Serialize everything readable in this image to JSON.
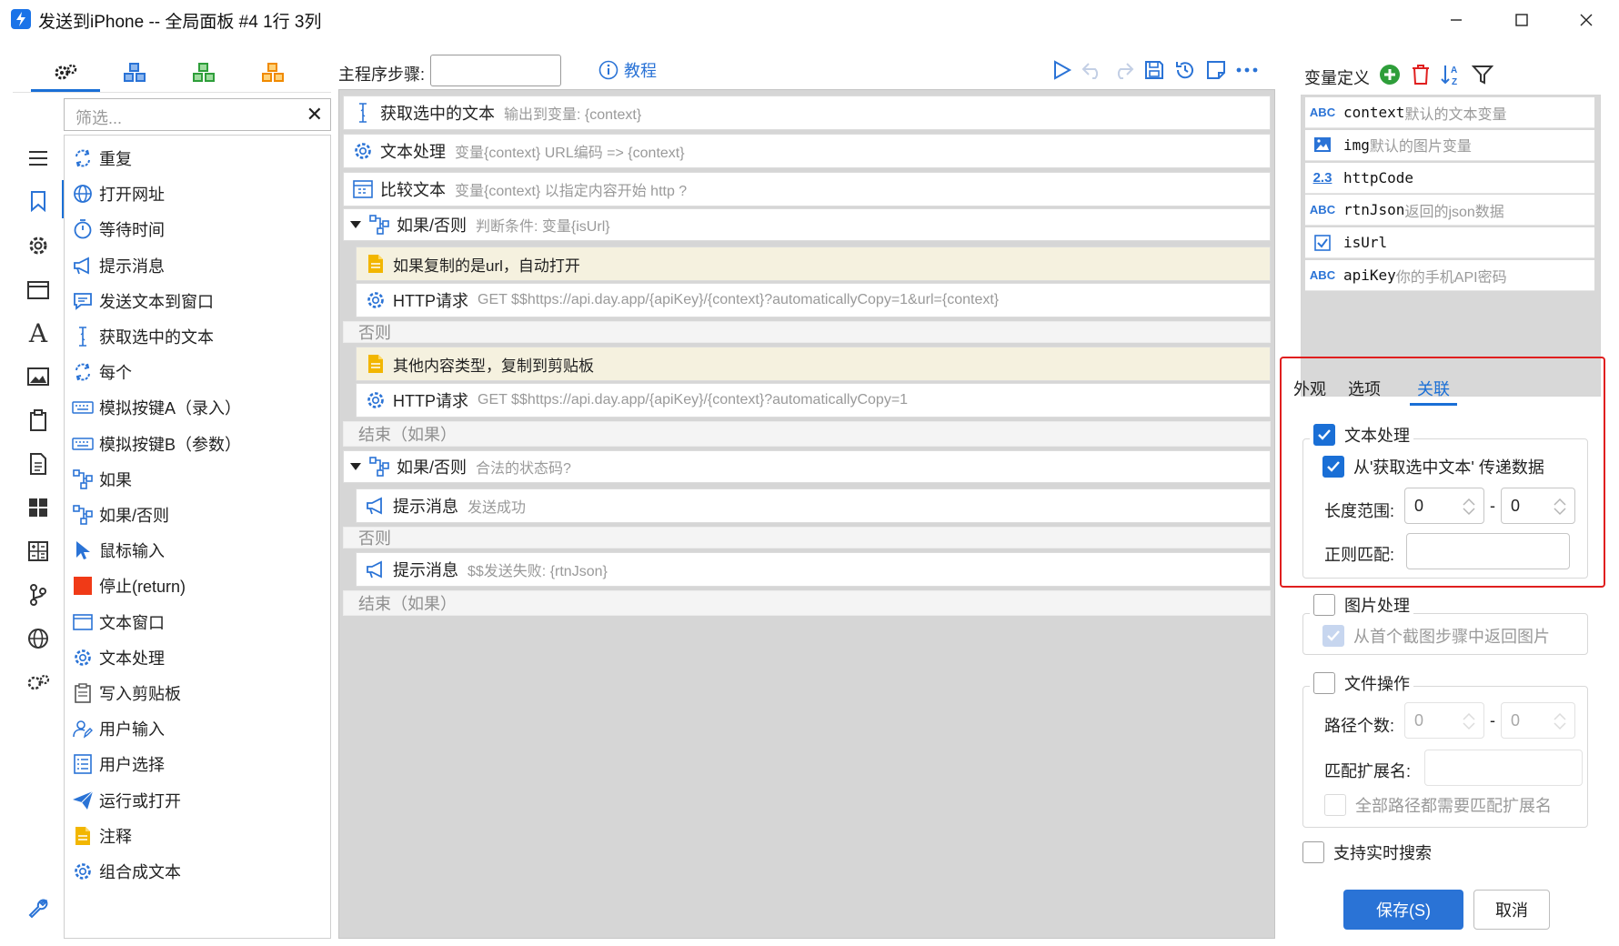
{
  "window": {
    "title": "发送到iPhone -- 全局面板 #4 1行 3列"
  },
  "left": {
    "top_tabs": [
      "gears-icon",
      "cubes-blue-icon",
      "cubes-green-icon",
      "cubes-orange-icon"
    ],
    "filter_placeholder": "筛选...",
    "filter_clear": "✕",
    "side_icons": [
      "menu-icon",
      "bookmark-icon",
      "gear-icon",
      "window-icon",
      "font-icon",
      "image-icon",
      "clipboard-icon",
      "document-icon",
      "windows-icon",
      "calculator-icon",
      "branch-icon",
      "globe-icon",
      "gears-icon",
      "wrench-icon"
    ],
    "steps": [
      {
        "label": "重复",
        "icon": "loop-icon"
      },
      {
        "label": "打开网址",
        "icon": "globe-icon"
      },
      {
        "label": "等待时间",
        "icon": "stopwatch-icon"
      },
      {
        "label": "提示消息",
        "icon": "megaphone-icon"
      },
      {
        "label": "发送文本到窗口",
        "icon": "message-icon"
      },
      {
        "label": "获取选中的文本",
        "icon": "text-cursor-icon"
      },
      {
        "label": "每个",
        "icon": "loop-icon"
      },
      {
        "label": "模拟按键A（录入）",
        "icon": "keyboard-icon"
      },
      {
        "label": "模拟按键B（参数）",
        "icon": "keyboard-icon"
      },
      {
        "label": "如果",
        "icon": "branch-icon"
      },
      {
        "label": "如果/否则",
        "icon": "branch-icon"
      },
      {
        "label": "鼠标输入",
        "icon": "cursor-icon"
      },
      {
        "label": "停止(return)",
        "icon": "stop-icon"
      },
      {
        "label": "文本窗口",
        "icon": "window-icon"
      },
      {
        "label": "文本处理",
        "icon": "gear-icon"
      },
      {
        "label": "写入剪贴板",
        "icon": "clipboard-icon"
      },
      {
        "label": "用户输入",
        "icon": "user-edit-icon"
      },
      {
        "label": "用户选择",
        "icon": "list-icon"
      },
      {
        "label": "运行或打开",
        "icon": "paper-plane-icon"
      },
      {
        "label": "注释",
        "icon": "note-icon"
      },
      {
        "label": "组合成文本",
        "icon": "gear-icon"
      }
    ]
  },
  "editor": {
    "main_steps_label": "主程序步骤:",
    "main_steps_value": "",
    "tutorial_label": "教程",
    "rows": [
      {
        "kind": "step",
        "title": "获取选中的文本",
        "hint": "输出到变量: {context}",
        "icon": "text-cursor-icon"
      },
      {
        "kind": "step",
        "title": "文本处理",
        "hint": "变量{context} URL编码 => {context}",
        "icon": "gear-icon"
      },
      {
        "kind": "step",
        "title": "比较文本",
        "hint": "变量{context} 以指定内容开始  http ?",
        "icon": "compare-icon"
      },
      {
        "kind": "branch",
        "title": "如果/否则",
        "hint": "判断条件: 变量{isUrl}",
        "icon": "branch-icon"
      },
      {
        "kind": "note",
        "title": "如果复制的是url，自动打开",
        "hint": "",
        "icon": "note-icon"
      },
      {
        "kind": "step",
        "title": "HTTP请求",
        "hint": "GET $$https://api.day.app/{apiKey}/{context}?automaticallyCopy=1&url={context}",
        "icon": "gear-icon"
      },
      {
        "kind": "label",
        "title": "否则",
        "hint": "",
        "icon": ""
      },
      {
        "kind": "note",
        "title": "其他内容类型，复制到剪贴板",
        "hint": "",
        "icon": "note-icon"
      },
      {
        "kind": "step",
        "title": "HTTP请求",
        "hint": "GET $$https://api.day.app/{apiKey}/{context}?automaticallyCopy=1",
        "icon": "gear-icon"
      },
      {
        "kind": "label",
        "title": "结束（如果）",
        "hint": "",
        "icon": ""
      },
      {
        "kind": "branch",
        "title": "如果/否则",
        "hint": "合法的状态码?",
        "icon": "branch-icon"
      },
      {
        "kind": "step",
        "title": "提示消息",
        "hint": "发送成功",
        "icon": "megaphone-icon"
      },
      {
        "kind": "label",
        "title": "否则",
        "hint": "",
        "icon": ""
      },
      {
        "kind": "step",
        "title": "提示消息",
        "hint": "$$发送失败: {rtnJson}",
        "icon": "megaphone-icon"
      },
      {
        "kind": "label",
        "title": "结束（如果）",
        "hint": "",
        "icon": ""
      }
    ]
  },
  "right": {
    "var_title": "变量定义",
    "variables": [
      {
        "badge": "ABC",
        "name": "context",
        "desc": "默认的文本变量"
      },
      {
        "badge": "image",
        "name": "img",
        "desc": "默认的图片变量"
      },
      {
        "badge": "2.3",
        "name": "httpCode",
        "desc": ""
      },
      {
        "badge": "ABC",
        "name": "rtnJson",
        "desc": "返回的json数据"
      },
      {
        "badge": "check",
        "name": "isUrl",
        "desc": ""
      },
      {
        "badge": "ABC",
        "name": "apiKey",
        "desc": "你的手机API密码"
      }
    ],
    "tabs": [
      "外观",
      "选项",
      "关联"
    ],
    "active_tab": "关联",
    "text_processing": {
      "label": "文本处理",
      "checked": true,
      "pass_label": "从'获取选中文本' 传递数据",
      "pass_checked": true,
      "length_label": "长度范围:",
      "length_from": "0",
      "length_to": "0",
      "dash": "-",
      "regex_label": "正则匹配:",
      "regex_value": ""
    },
    "image_processing": {
      "label": "图片处理",
      "checked": false,
      "sub_label": "从首个截图步骤中返回图片",
      "sub_checked": true
    },
    "file_ops": {
      "label": "文件操作",
      "checked": false,
      "path_count_label": "路径个数:",
      "path_from": "0",
      "path_to": "0",
      "dash": "-",
      "ext_label": "匹配扩展名:",
      "ext_value": "",
      "all_paths_label": "全部路径都需要匹配扩展名"
    },
    "realtime_search_label": "支持实时搜索",
    "save_label": "保存(S)",
    "cancel_label": "取消"
  },
  "colors": {
    "accent": "#1a6fd6",
    "highlight_border": "#e01f1f",
    "note_bg": "#f5f1df",
    "canvas_bg": "#d6d6d6"
  }
}
